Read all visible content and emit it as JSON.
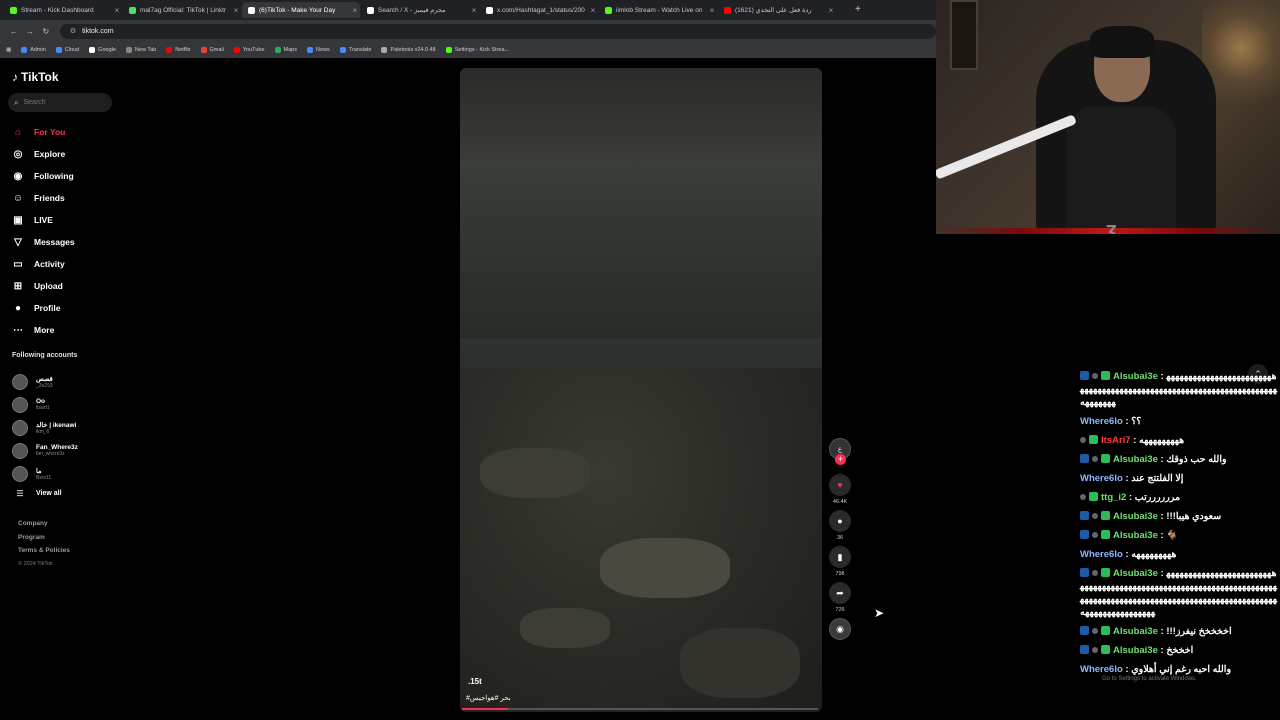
{
  "browser": {
    "tabs": [
      {
        "label": "Stream - Kick Dashboard",
        "favicon_color": "#53fc18"
      },
      {
        "label": "mal7ag Official: TikTok | Linktr",
        "favicon_color": "#43e660"
      },
      {
        "label": "(6)TikTok - Make Your Day",
        "favicon_color": "#ffffff"
      },
      {
        "label": "Search / X - محرم فيمبز",
        "favicon_color": "#ffffff"
      },
      {
        "label": "x.com/Hashtagat_1/status/200",
        "favicon_color": "#ffffff"
      },
      {
        "label": "iimlob Stream - Watch Live on",
        "favicon_color": "#53fc18"
      },
      {
        "label": "(1621) ردة فعل على التحدي",
        "favicon_color": "#ff0000"
      }
    ],
    "new_tab_symbol": "+",
    "address": "tiktok.com",
    "bookmarks": [
      {
        "label": "Admin",
        "color": "#4a8af4"
      },
      {
        "label": "Cloud",
        "color": "#4a8af4"
      },
      {
        "label": "Google",
        "color": "#ffffff"
      },
      {
        "label": "New Tab",
        "color": "#888888"
      },
      {
        "label": "Netflix",
        "color": "#e50914"
      },
      {
        "label": "Gmail",
        "color": "#ea4335"
      },
      {
        "label": "YouTube",
        "color": "#ff0000"
      },
      {
        "label": "Maps",
        "color": "#34a853"
      },
      {
        "label": "News",
        "color": "#4a8af4"
      },
      {
        "label": "Translate",
        "color": "#4a8af4"
      },
      {
        "label": "Paletools v24.0.48",
        "color": "#aaaaaa"
      },
      {
        "label": "Settings - Kick Strea...",
        "color": "#53fc18"
      }
    ]
  },
  "tiktok": {
    "logo": "TikTok",
    "search_placeholder": "Search",
    "nav": [
      {
        "label": "For You",
        "icon": "home-icon",
        "active": true
      },
      {
        "label": "Explore",
        "icon": "compass-icon"
      },
      {
        "label": "Following",
        "icon": "following-icon"
      },
      {
        "label": "Friends",
        "icon": "friends-icon"
      },
      {
        "label": "LIVE",
        "icon": "live-icon"
      },
      {
        "label": "Messages",
        "icon": "messages-icon"
      },
      {
        "label": "Activity",
        "icon": "activity-icon"
      },
      {
        "label": "Upload",
        "icon": "upload-icon"
      },
      {
        "label": "Profile",
        "icon": "profile-icon"
      },
      {
        "label": "More",
        "icon": "more-icon"
      }
    ],
    "following_title": "Following accounts",
    "following": [
      {
        "name": "قصص",
        "user": "_2e293"
      },
      {
        "name": "Oo",
        "user": "itsarf1"
      },
      {
        "name": "خالد | ikenawi",
        "user": "ikm_6"
      },
      {
        "name": "Fan_Where3z",
        "user": "fan_where3z"
      },
      {
        "name": "ما",
        "user": "Bsrs11"
      }
    ],
    "view_all": "View all",
    "footer": [
      "Company",
      "Program",
      "Terms & Policies"
    ],
    "copyright": "© 2024 TikTok",
    "video": {
      "caption": ".15t",
      "hashtags": "#بحر #هواجيس",
      "progress": 0.13,
      "likes": "46.4K",
      "comments": "36",
      "saves": "798",
      "shares": "726",
      "author_initial": "ع"
    }
  },
  "chat": {
    "messages": [
      {
        "user": "Alsubai3e",
        "user_color": "green",
        "text": "هههههههههههههههههههههههههههههههههههههههههههههههههههههههههههههههههههههههههههههه",
        "badges": [
          "blue",
          "s",
          "g"
        ]
      },
      {
        "user": "Where6lo",
        "user_color": "blue",
        "text": "؟؟",
        "badges": []
      },
      {
        "user": "ItsAri7",
        "user_color": "red",
        "text": "هههههههههه",
        "badges": [
          "s",
          "g"
        ]
      },
      {
        "user": "Alsubai3e",
        "user_color": "green",
        "text": "والله حب ذوقك",
        "badges": [
          "blue",
          "s",
          "g"
        ]
      },
      {
        "user": "Where6lo",
        "user_color": "blue",
        "text": "إلا الفلتتج عند",
        "badges": []
      },
      {
        "user": "ttg_i2",
        "user_color": "green",
        "text": "مررررررتب",
        "badges": [
          "s",
          "g"
        ]
      },
      {
        "user": "Alsubai3e",
        "user_color": "green",
        "text": "سعودي هيبا!!!",
        "badges": [
          "blue",
          "s",
          "g"
        ]
      },
      {
        "user": "Alsubai3e",
        "user_color": "green",
        "text": "🐐",
        "badges": [
          "blue",
          "s",
          "g"
        ]
      },
      {
        "user": "Where6lo",
        "user_color": "blue",
        "text": "هههههههههه",
        "badges": []
      },
      {
        "user": "Alsubai3e",
        "user_color": "green",
        "text": "هههههههههههههههههههههههههههههههههههههههههههههههههههههههههههههههههههههههههههههههههههههههههههههههههههههههههههههههههههههههههههههههههههه",
        "badges": [
          "blue",
          "s",
          "g"
        ]
      },
      {
        "user": "Alsubai3e",
        "user_color": "green",
        "text": "اخخخخخ نيفرز!!!",
        "badges": [
          "blue",
          "s",
          "g"
        ]
      },
      {
        "user": "Alsubai3e",
        "user_color": "green",
        "text": "اخخخخ",
        "badges": [
          "blue",
          "s",
          "g"
        ]
      },
      {
        "user": "Where6lo",
        "user_color": "blue",
        "text": "والله احبه رغم إني أهلاوي",
        "badges": []
      }
    ],
    "watermark": "Go to Settings to activate Windows."
  }
}
